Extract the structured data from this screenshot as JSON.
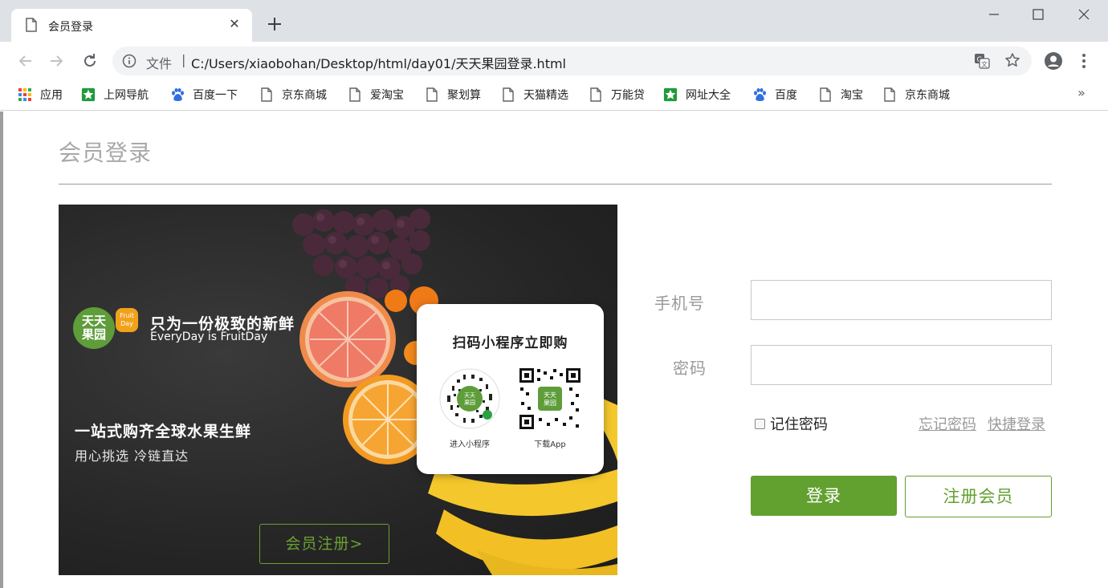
{
  "browser": {
    "tab_title": "会员登录",
    "url_scheme": "文件",
    "url_separator": "|",
    "url": "C:/Users/xiaobohan/Desktop/html/day01/天天果园登录.html",
    "bookmarks": [
      {
        "label": "应用",
        "icon": "apps-grid-icon"
      },
      {
        "label": "上网导航",
        "icon": "green-star-icon"
      },
      {
        "label": "百度一下",
        "icon": "baidu-paw-icon"
      },
      {
        "label": "京东商城",
        "icon": "page-icon"
      },
      {
        "label": "爱淘宝",
        "icon": "page-icon"
      },
      {
        "label": "聚划算",
        "icon": "page-icon"
      },
      {
        "label": "天猫精选",
        "icon": "page-icon"
      },
      {
        "label": "万能贷",
        "icon": "page-icon"
      },
      {
        "label": "网址大全",
        "icon": "green-star-icon"
      },
      {
        "label": "百度",
        "icon": "baidu-paw-icon"
      },
      {
        "label": "淘宝",
        "icon": "page-icon"
      },
      {
        "label": "京东商城",
        "icon": "page-icon"
      }
    ],
    "bookmarks_more": "»"
  },
  "page": {
    "title": "会员登录",
    "banner": {
      "logo_text": "天天\n果园",
      "badge_text": "Fruit\nDay",
      "slogan": "只为一份极致的新鲜",
      "slogan_en": "EveryDay is FruitDay",
      "headline": "一站式购齐全球水果生鲜",
      "subline": "用心挑选 冷链直达",
      "qr_title": "扫码小程序立即购",
      "qr_caption_mini": "进入小程序",
      "qr_caption_app": "下载App",
      "register_button": "会员注册>"
    },
    "form": {
      "phone_label": "手机号",
      "phone_value": "",
      "password_label": "密码",
      "password_value": "",
      "remember_label": "记住密码",
      "remember_checked": false,
      "forgot_link": "忘记密码",
      "quick_login_link": "快捷登录",
      "login_button": "登录",
      "register_button": "注册会员"
    }
  },
  "colors": {
    "brand_green": "#62a030",
    "label_gray": "#9a9a9a",
    "chrome_bg": "#dee1e6"
  }
}
